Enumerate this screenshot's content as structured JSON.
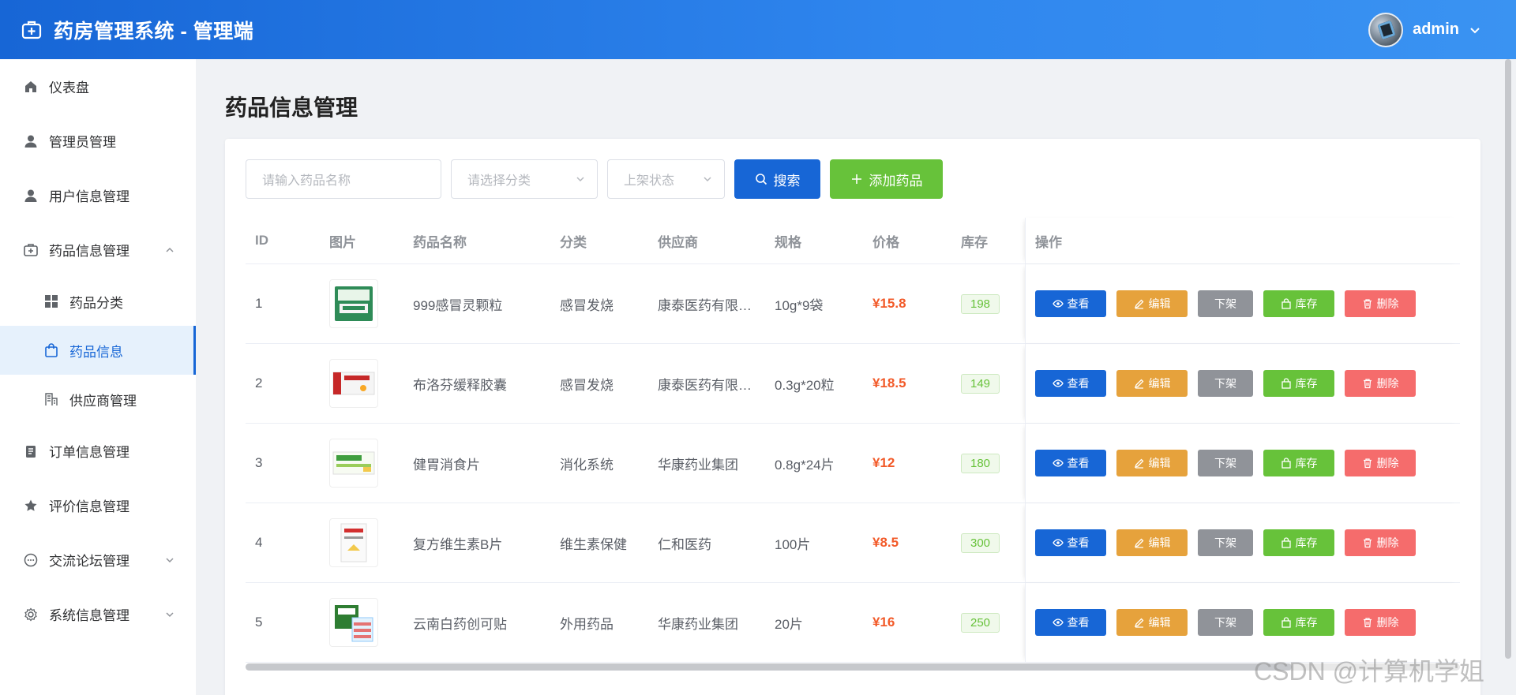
{
  "header": {
    "title": "药房管理系统 - 管理端",
    "username": "admin"
  },
  "sidebar": {
    "items": [
      {
        "label": "仪表盘",
        "icon": "home-icon"
      },
      {
        "label": "管理员管理",
        "icon": "user-icon"
      },
      {
        "label": "用户信息管理",
        "icon": "user-icon"
      },
      {
        "label": "药品信息管理",
        "icon": "medkit-icon",
        "expanded": true,
        "children": [
          {
            "label": "药品分类",
            "icon": "grid-icon"
          },
          {
            "label": "药品信息",
            "icon": "bag-icon",
            "active": true
          },
          {
            "label": "供应商管理",
            "icon": "building-icon"
          }
        ]
      },
      {
        "label": "订单信息管理",
        "icon": "document-icon"
      },
      {
        "label": "评价信息管理",
        "icon": "star-icon"
      },
      {
        "label": "交流论坛管理",
        "icon": "chat-icon",
        "expanded": false
      },
      {
        "label": "系统信息管理",
        "icon": "settings-icon",
        "expanded": false
      }
    ]
  },
  "page": {
    "title": "药品信息管理"
  },
  "filters": {
    "name_placeholder": "请输入药品名称",
    "category_placeholder": "请选择分类",
    "status_placeholder": "上架状态",
    "search_label": "搜索",
    "add_label": "添加药品"
  },
  "table": {
    "columns": [
      "ID",
      "图片",
      "药品名称",
      "分类",
      "供应商",
      "规格",
      "价格",
      "库存",
      "操作"
    ],
    "rows": [
      {
        "id": "1",
        "name": "999感冒灵颗粒",
        "category": "感冒发烧",
        "supplier": "康泰医药有限…",
        "spec": "10g*9袋",
        "price": "¥15.8",
        "stock": "198"
      },
      {
        "id": "2",
        "name": "布洛芬缓释胶囊",
        "category": "感冒发烧",
        "supplier": "康泰医药有限…",
        "spec": "0.3g*20粒",
        "price": "¥18.5",
        "stock": "149"
      },
      {
        "id": "3",
        "name": "健胃消食片",
        "category": "消化系统",
        "supplier": "华康药业集团",
        "spec": "0.8g*24片",
        "price": "¥12",
        "stock": "180"
      },
      {
        "id": "4",
        "name": "复方维生素B片",
        "category": "维生素保健",
        "supplier": "仁和医药",
        "spec": "100片",
        "price": "¥8.5",
        "stock": "300"
      },
      {
        "id": "5",
        "name": "云南白药创可贴",
        "category": "外用药品",
        "supplier": "华康药业集团",
        "spec": "20片",
        "price": "¥16",
        "stock": "250"
      }
    ],
    "actions": {
      "view": "查看",
      "edit": "编辑",
      "off": "下架",
      "stock": "库存",
      "delete": "删除"
    }
  },
  "watermark": "CSDN @计算机学姐",
  "colors": {
    "primary": "#1766d6",
    "success": "#67c23a",
    "warning": "#e6a23c",
    "info": "#909399",
    "danger": "#f56c6c",
    "price": "#f25a29"
  }
}
